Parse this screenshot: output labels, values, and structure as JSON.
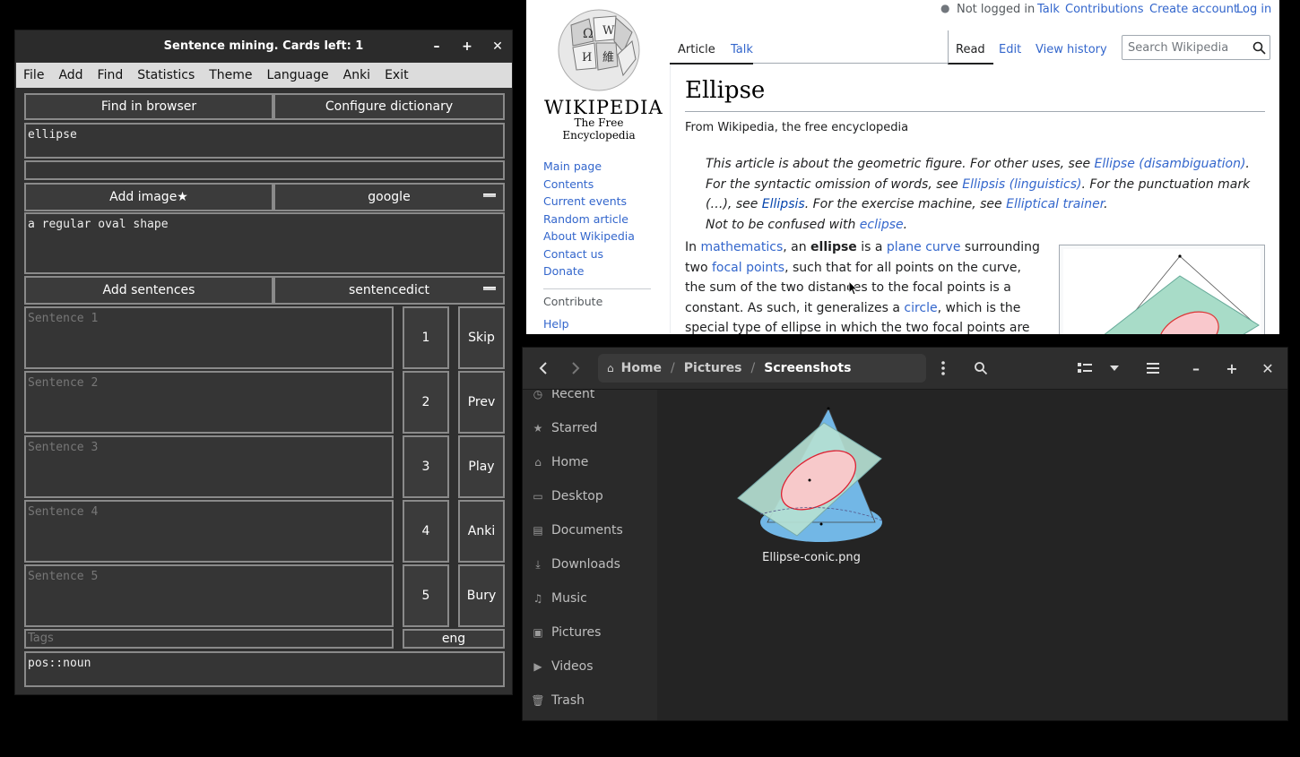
{
  "sm": {
    "title": "Sentence mining. Cards left: 1",
    "minimize": "–",
    "maximize": "+",
    "close": "✕",
    "menu": [
      "File",
      "Add",
      "Find",
      "Statistics",
      "Theme",
      "Language",
      "Anki",
      "Exit"
    ],
    "find_in_browser": "Find in browser",
    "configure_dictionary": "Configure dictionary",
    "word": "ellipse",
    "extra": "",
    "add_image": "Add image★",
    "image_source": "google",
    "definition": "a regular oval shape",
    "add_sentences": "Add sentences",
    "sentence_source": "sentencedict",
    "sentences": [
      {
        "placeholder": "Sentence 1",
        "num": "1",
        "action": "Skip"
      },
      {
        "placeholder": "Sentence 2",
        "num": "2",
        "action": "Prev"
      },
      {
        "placeholder": "Sentence 3",
        "num": "3",
        "action": "Play"
      },
      {
        "placeholder": "Sentence 4",
        "num": "4",
        "action": "Anki"
      },
      {
        "placeholder": "Sentence 5",
        "num": "5",
        "action": "Bury"
      }
    ],
    "tags_placeholder": "Tags",
    "lang": "eng",
    "tags_value": "pos::noun"
  },
  "wiki": {
    "logo_word": "WIKIPEDIA",
    "logo_tagline": "The Free Encyclopedia",
    "user": {
      "not_logged": "Not logged in",
      "talk": "Talk",
      "contributions": "Contributions",
      "create_account": "Create account",
      "login": "Log in"
    },
    "tabs": {
      "article": "Article",
      "talk": "Talk",
      "read": "Read",
      "edit": "Edit",
      "history": "View history"
    },
    "search_placeholder": "Search Wikipedia",
    "nav": [
      "Main page",
      "Contents",
      "Current events",
      "Random article",
      "About Wikipedia",
      "Contact us",
      "Donate"
    ],
    "contribute_heading": "Contribute",
    "help": "Help",
    "title": "Ellipse",
    "from": "From Wikipedia, the free encyclopedia",
    "hatnote1_a": "This article is about the geometric figure. For other uses, see ",
    "hatnote1_link": "Ellipse (disambiguation)",
    "hatnote1_b": ".",
    "hatnote2_a": "For the syntactic omission of words, see ",
    "hatnote2_link": "Ellipsis (linguistics)",
    "hatnote2_b": ". For the punctuation mark",
    "hatnote3_a": "(…), see ",
    "hatnote3_link": "Ellipsis",
    "hatnote3_b": ". For the exercise machine, see ",
    "hatnote3_link2": "Elliptical trainer",
    "hatnote3_c": ".",
    "hatnote4_a": "Not to be confused with ",
    "hatnote4_link": "eclipse",
    "hatnote4_b": ".",
    "body": {
      "p1": "In ",
      "l1": "mathematics",
      "p2": ", an ",
      "b1": "ellipse",
      "p3": " is a ",
      "l2": "plane curve",
      "p4": " surrounding",
      "p5": "two ",
      "l3": "focal points",
      "p6": ", such that for all points on the curve,",
      "p7": "the sum of the two distances to the focal points is a",
      "p8": "constant. As such, it generalizes a ",
      "l4": "circle",
      "p9": ", which is the",
      "p10": "special type of ellipse in which the two focal points are"
    }
  },
  "files": {
    "path": [
      "Home",
      "Pictures",
      "Screenshots"
    ],
    "sidebar": [
      "Recent",
      "Starred",
      "Home",
      "Desktop",
      "Documents",
      "Downloads",
      "Music",
      "Pictures",
      "Videos",
      "Trash"
    ],
    "file_name": "Ellipse-conic.png",
    "minimize": "–",
    "maximize": "+",
    "close": "✕"
  }
}
